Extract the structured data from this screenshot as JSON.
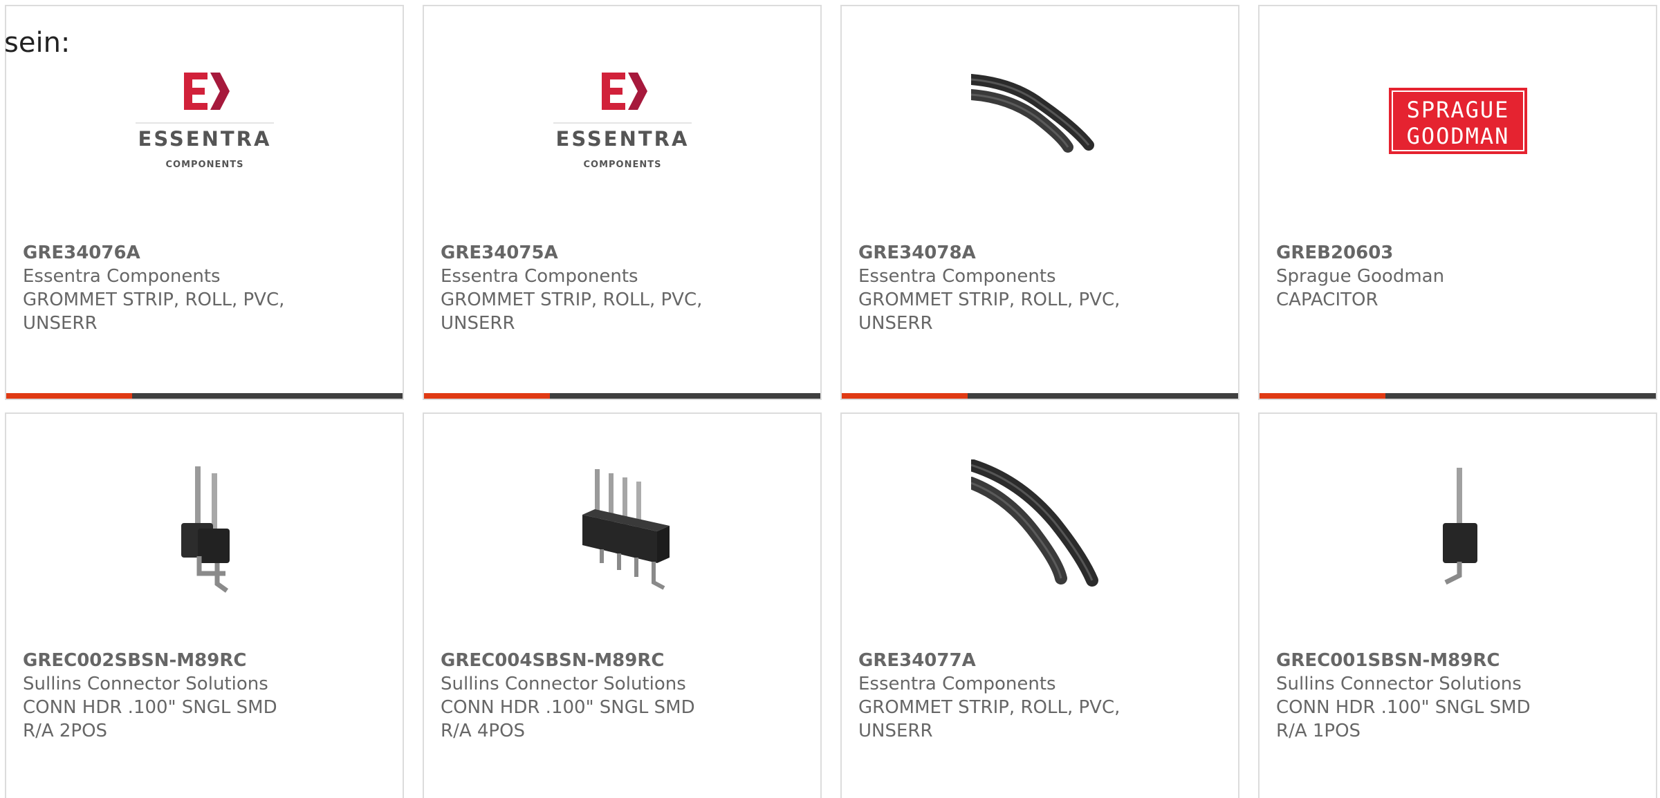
{
  "intro_text": "sein:",
  "colors": {
    "accent": "#e03a14",
    "bar_dark": "#3f3f3f",
    "text": "#666666",
    "border": "#dcdcdc"
  },
  "logos": {
    "essentra": {
      "name": "ESSENTRA",
      "sub": "COMPONENTS"
    },
    "sprague": {
      "line1": "SPRAGUE",
      "line2": "GOODMAN"
    }
  },
  "products": [
    {
      "sku": "GRE34076A",
      "manufacturer": "Essentra Components",
      "description": "GROMMET STRIP, ROLL, PVC, UNSERR",
      "image": "essentra-logo"
    },
    {
      "sku": "GRE34075A",
      "manufacturer": "Essentra Components",
      "description": "GROMMET STRIP, ROLL, PVC, UNSERR",
      "image": "essentra-logo"
    },
    {
      "sku": "GRE34078A",
      "manufacturer": "Essentra Components",
      "description": "GROMMET STRIP, ROLL, PVC, UNSERR",
      "image": "grommet-strip-photo"
    },
    {
      "sku": "GREB20603",
      "manufacturer": "Sprague Goodman",
      "description": "CAPACITOR",
      "image": "sprague-goodman-logo"
    },
    {
      "sku": "GREC002SBSN-M89RC",
      "manufacturer": "Sullins Connector Solutions",
      "description": "CONN HDR .100\" SNGL SMD R/A 2POS",
      "image": "header-2pos-photo"
    },
    {
      "sku": "GREC004SBSN-M89RC",
      "manufacturer": "Sullins Connector Solutions",
      "description": "CONN HDR .100\" SNGL SMD R/A 4POS",
      "image": "header-4pos-photo"
    },
    {
      "sku": "GRE34077A",
      "manufacturer": "Essentra Components",
      "description": "GROMMET STRIP, ROLL, PVC, UNSERR",
      "image": "grommet-strip-photo"
    },
    {
      "sku": "GREC001SBSN-M89RC",
      "manufacturer": "Sullins Connector Solutions",
      "description": "CONN HDR .100\" SNGL SMD R/A 1POS",
      "image": "header-1pos-photo"
    }
  ]
}
